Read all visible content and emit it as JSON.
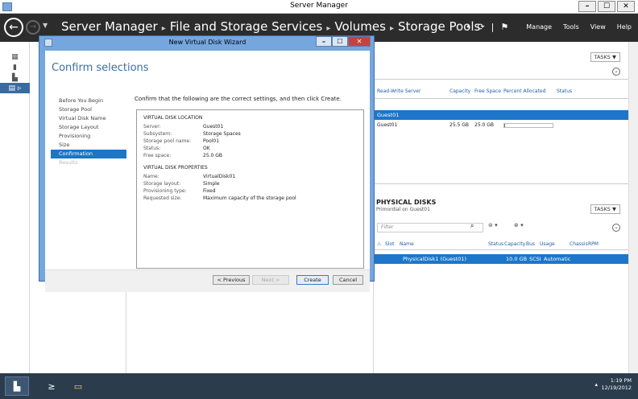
{
  "window": {
    "title": "Server Manager",
    "min": "–",
    "max": "☐",
    "close": "✕"
  },
  "header": {
    "breadcrumb": [
      "Server Manager",
      "File and Storage Services",
      "Volumes",
      "Storage Pools"
    ],
    "menu": [
      "Manage",
      "Tools",
      "View",
      "Help"
    ]
  },
  "top_panel": {
    "tasks_label": "TASKS ▼",
    "columns": [
      "Read-Write Server",
      "Capacity",
      "Free Space",
      "Percent Allocated",
      "Status"
    ],
    "group_row": "Guest01",
    "rows": [
      {
        "server": "Guest01",
        "capacity": "25.5 GB",
        "free": "25.0 GB",
        "percent": 2,
        "status": ""
      }
    ]
  },
  "physical_disks": {
    "title": "PHYSICAL DISKS",
    "subtitle": "Primordial on Guest01",
    "tasks_label": "TASKS ▼",
    "filter_placeholder": "Filter",
    "columns": [
      "Slot",
      "Name",
      "Status",
      "Capacity",
      "Bus",
      "Usage",
      "Chassis",
      "RPM"
    ],
    "rows": [
      {
        "slot": "",
        "name": "PhysicalDisk1 (Guest01)",
        "status": "",
        "capacity": "10.0 GB",
        "bus": "SCSI",
        "usage": "Automatic",
        "chassis": "",
        "rpm": ""
      }
    ]
  },
  "dialog": {
    "title": "New Virtual Disk Wizard",
    "heading": "Confirm selections",
    "steps": [
      "Before You Begin",
      "Storage Pool",
      "Virtual Disk Name",
      "Storage Layout",
      "Provisioning",
      "Size",
      "Confirmation",
      "Results"
    ],
    "instruction": "Confirm that the following are the correct settings, and then click Create.",
    "location": {
      "section": "VIRTUAL DISK LOCATION",
      "items": [
        {
          "k": "Server:",
          "v": "Guest01"
        },
        {
          "k": "Subsystem:",
          "v": "Storage Spaces"
        },
        {
          "k": "Storage pool name:",
          "v": "Pool01"
        },
        {
          "k": "Status:",
          "v": "OK"
        },
        {
          "k": "Free space:",
          "v": "25.0 GB"
        }
      ]
    },
    "properties": {
      "section": "VIRTUAL DISK PROPERTIES",
      "items": [
        {
          "k": "Name:",
          "v": "VirtualDisk01"
        },
        {
          "k": "Storage layout:",
          "v": "Simple"
        },
        {
          "k": "Provisioning type:",
          "v": "Fixed"
        },
        {
          "k": "Requested size:",
          "v": "Maximum capacity of the storage pool"
        }
      ]
    },
    "buttons": {
      "previous": "< Previous",
      "next": "Next >",
      "create": "Create",
      "cancel": "Cancel"
    }
  },
  "taskbar": {
    "time": "1:19 PM",
    "date": "12/19/2012"
  },
  "colors": {
    "accent": "#1c76c9",
    "header": "#2c2c2c",
    "dialog_frame": "#75a7de",
    "heading": "#3b6ea5"
  }
}
